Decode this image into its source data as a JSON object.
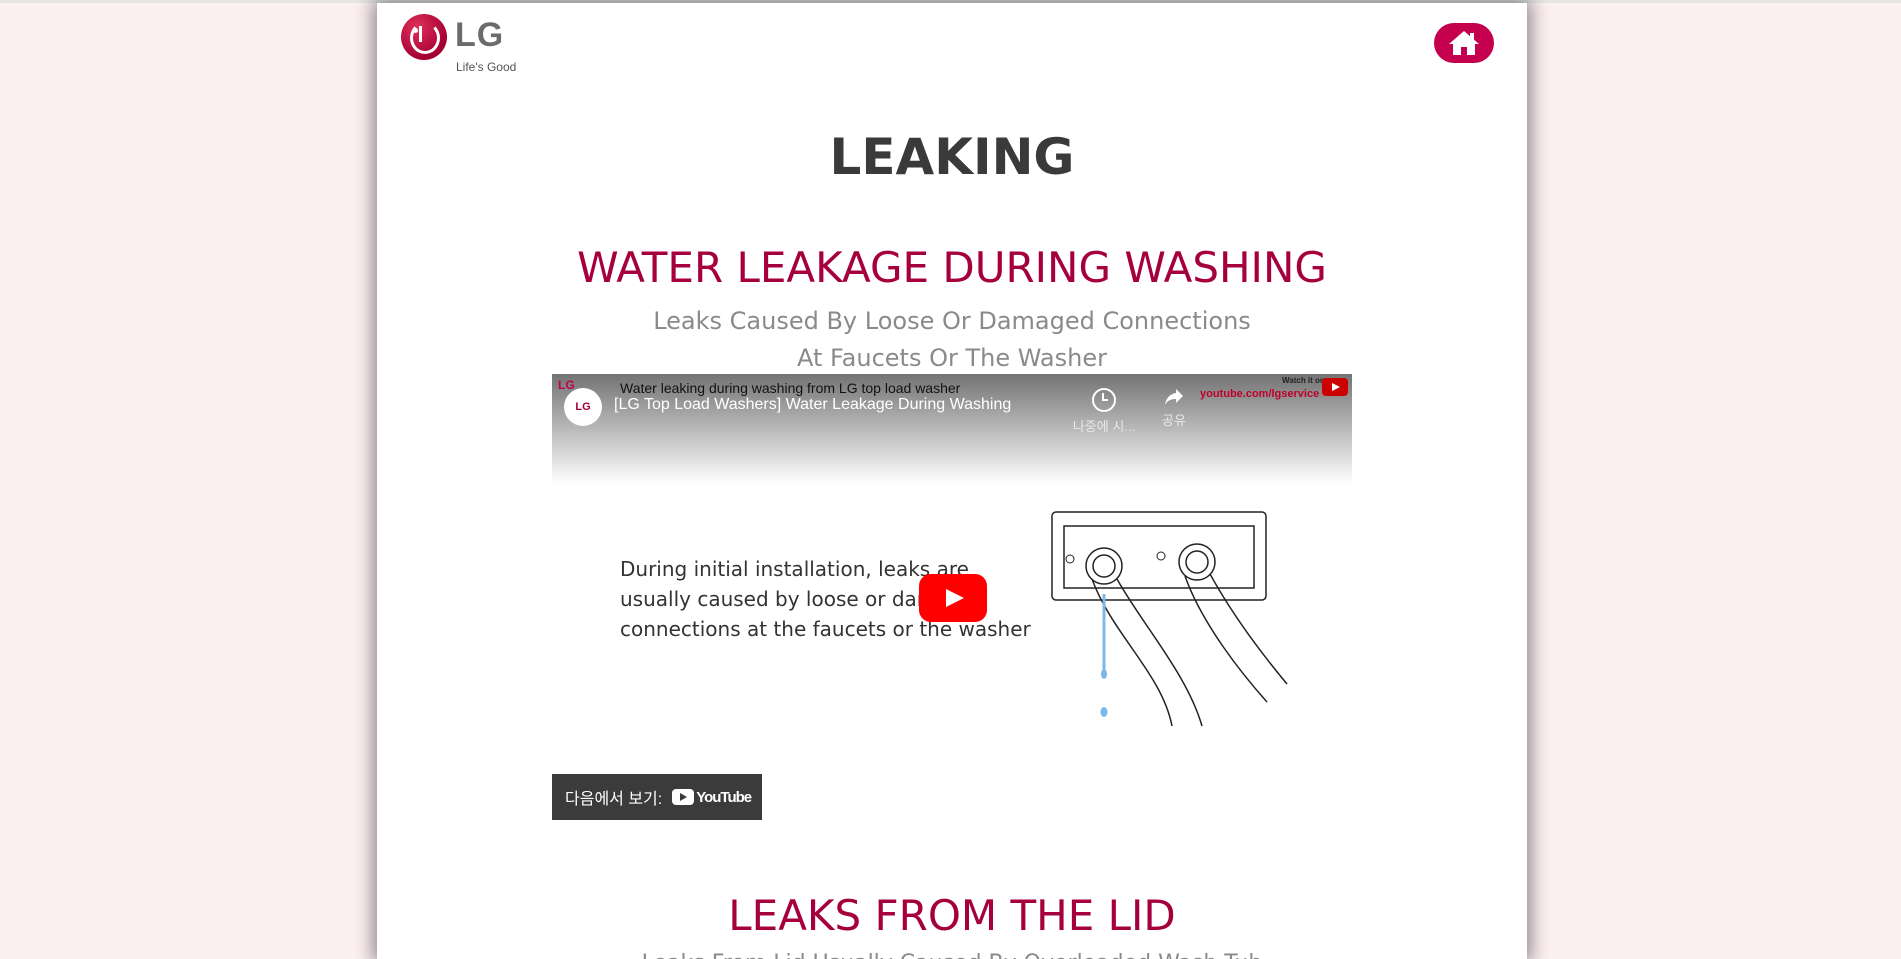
{
  "brand": {
    "name": "LG",
    "tagline": "Life's Good",
    "accent_color": "#a50034",
    "home_button_color": "#c4004f"
  },
  "header": {
    "home_icon": "home-icon"
  },
  "page": {
    "title": "LEAKING"
  },
  "section1": {
    "heading": "WATER LEAKAGE DURING WASHING",
    "subtitle_line1": "Leaks Caused By Loose Or Damaged Connections",
    "subtitle_line2": "At Faucets Or The Washer"
  },
  "video": {
    "top_caption": "Water leaking during washing from LG top load washer",
    "title": "[LG Top Load Washers] Water Leakage During Washing",
    "channel_avatar_text": "LG",
    "watch_on_text": "Watch it on",
    "url_text": "youtube.com/lgservice",
    "watch_later_label": "나중에 시...",
    "share_label": "공유",
    "frame_text_line1": "During initial installation, leaks are",
    "frame_text_line2": "usually caused by loose or damaged",
    "frame_text_line3": "connections at the faucets or the washer",
    "watch_on_youtube_label": "다음에서 보기:",
    "youtube_word": "YouTube"
  },
  "section2": {
    "heading": "LEAKS FROM THE LID",
    "subtitle_line1": "Leaks From Lid Usually Caused By Overloaded Wash Tub"
  }
}
